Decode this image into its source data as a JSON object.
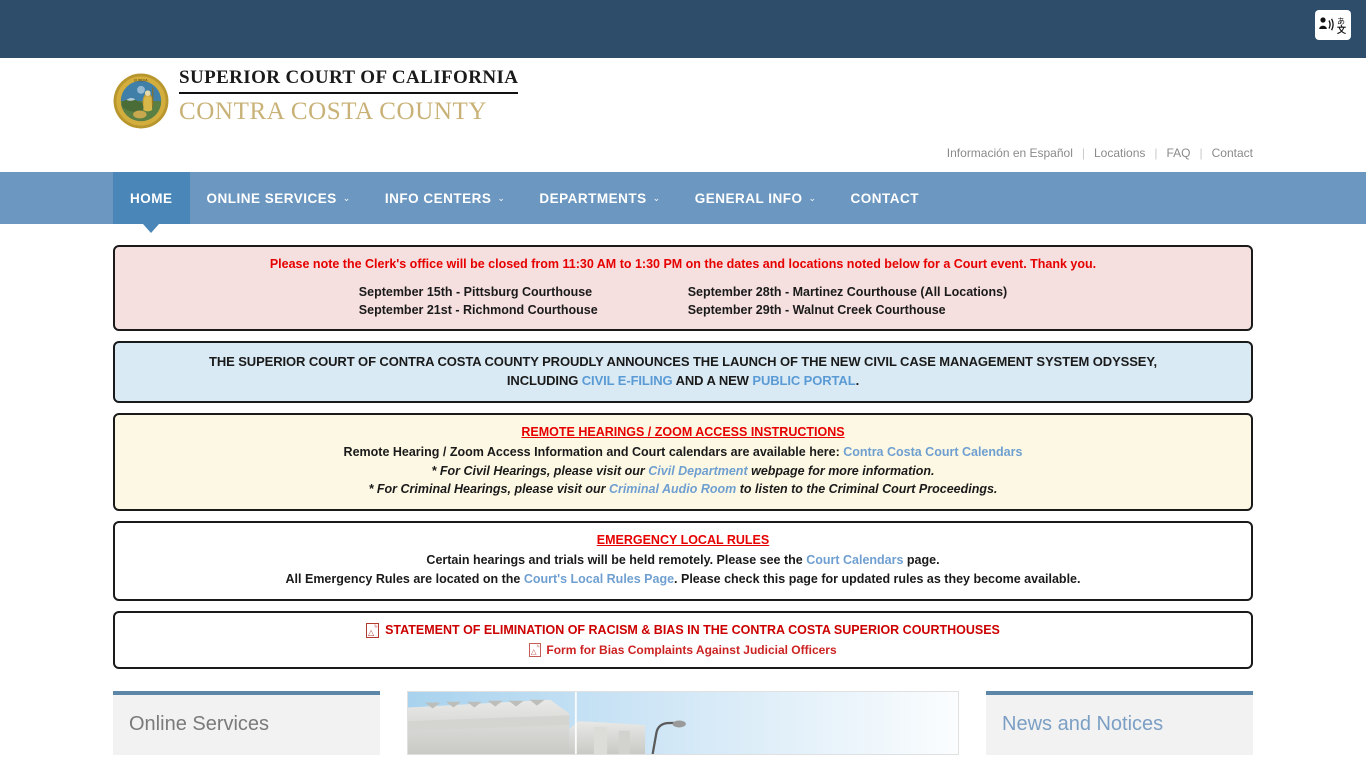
{
  "topbar": {
    "accessibility_widget": "accessibility-translate-widget"
  },
  "header": {
    "seal_alt": "california-state-seal",
    "title_line1": "SUPERIOR COURT OF CALIFORNIA",
    "title_line2": "CONTRA COSTA COUNTY",
    "utility_links": [
      {
        "label": "Información en Español"
      },
      {
        "label": "Locations"
      },
      {
        "label": "FAQ"
      },
      {
        "label": "Contact"
      }
    ]
  },
  "nav": {
    "items": [
      {
        "label": "HOME",
        "active": true,
        "has_caret": false
      },
      {
        "label": "ONLINE SERVICES",
        "active": false,
        "has_caret": true
      },
      {
        "label": "INFO CENTERS",
        "active": false,
        "has_caret": true
      },
      {
        "label": "DEPARTMENTS",
        "active": false,
        "has_caret": true
      },
      {
        "label": "GENERAL INFO",
        "active": false,
        "has_caret": true
      },
      {
        "label": "CONTACT",
        "active": false,
        "has_caret": false
      }
    ],
    "caret_glyph": "⌄"
  },
  "banners": {
    "clerk_closure": {
      "title": "Please note the Clerk's office will be closed from 11:30 AM to 1:30 PM on the dates and locations noted below for a Court event. Thank you.",
      "column_left": [
        "September 15th  -  Pittsburg Courthouse",
        "September 21st  -  Richmond Courthouse"
      ],
      "column_right": [
        "September 28th  -  Martinez Courthouse (All Locations)",
        "September 29th  -  Walnut Creek Courthouse"
      ]
    },
    "odyssey": {
      "line1": "THE SUPERIOR COURT OF CONTRA COSTA COUNTY PROUDLY ANNOUNCES THE LAUNCH OF THE NEW CIVIL CASE MANAGEMENT SYSTEM ODYSSEY,",
      "line2_pre": "INCLUDING ",
      "link1": "CIVIL E-FILING",
      "line2_mid": " AND A NEW ",
      "link2": "PUBLIC PORTAL",
      "line2_post": "."
    },
    "remote_hearings": {
      "title": "REMOTE HEARINGS / ZOOM ACCESS INSTRUCTIONS",
      "line1_pre": "Remote Hearing / Zoom Access Information and Court calendars are available here: ",
      "line1_link": "Contra Costa Court Calendars",
      "line2_pre": "* For Civil Hearings, please visit our ",
      "line2_link": "Civil Department",
      "line2_post": " webpage for more information.",
      "line3_pre": "* For Criminal Hearings, please visit our ",
      "line3_link": "Criminal Audio Room",
      "line3_post": " to listen to the Criminal Court Proceedings."
    },
    "emergency_rules": {
      "title": "EMERGENCY LOCAL RULES",
      "line1_pre": "Certain hearings and trials will be held remotely. Please see the ",
      "line1_link": "Court Calendars",
      "line1_post": " page.",
      "line2_pre": "All Emergency Rules are located on the ",
      "line2_link": "Court's Local Rules Page",
      "line2_post": ". Please check this page for updated rules as they become available."
    },
    "racism_statement": {
      "icon1": "pdf-icon",
      "line1": "STATEMENT OF ELIMINATION OF RACISM & BIAS IN THE CONTRA COSTA SUPERIOR COURTHOUSES",
      "icon2": "pdf-icon",
      "line2": "Form for Bias Complaints Against Judicial Officers"
    }
  },
  "panels": {
    "online_services_title": "Online Services",
    "carousel_alt": "courthouse-building-photo",
    "news_title": "News and Notices"
  },
  "colors": {
    "topbar": "#2d4d6b",
    "nav": "#6b97c0",
    "nav_active": "#4a87b8",
    "gold": "#c9b277",
    "alert_red": "#e60000",
    "link_blue": "#5b9bd5",
    "pink_bg": "#f5dfdf",
    "blue_bg": "#d9eaf4",
    "cream_bg": "#fdf8e4"
  }
}
